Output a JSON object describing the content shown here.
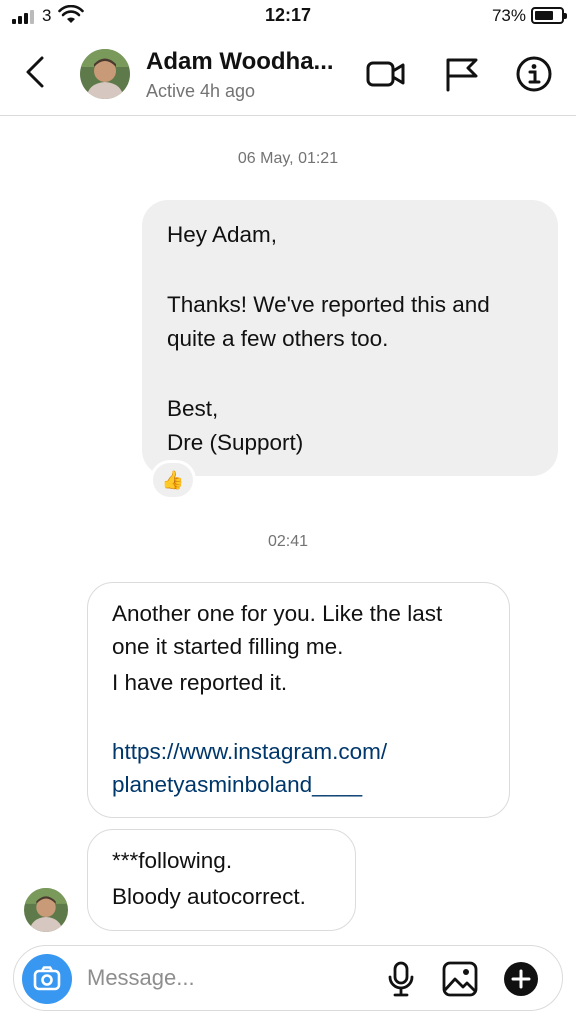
{
  "status_bar": {
    "carrier": "3",
    "time": "12:17",
    "battery": "73%",
    "battery_level": 0.73
  },
  "header": {
    "contact_name": "Adam Woodha...",
    "status": "Active 4h ago",
    "icons": [
      "back-icon",
      "video-call-icon",
      "flag-icon",
      "info-icon"
    ]
  },
  "messages": {
    "timestamp_1": "06 May, 01:21",
    "sent_1": {
      "line1": "Hey Adam,",
      "line2": "Thanks! We've reported this and",
      "line3": "quite a few others too.",
      "line4": "Best,",
      "line5": "Dre (Support)",
      "reaction": "👍"
    },
    "timestamp_2": "02:41",
    "received_1": {
      "line1": "Another one for you. Like the last",
      "line2": "one it started filling me.",
      "line3": "I have reported it.",
      "link1": "https://www.instagram.com/",
      "link2": "planetyasminboland____"
    },
    "received_2": {
      "line1": "***following.",
      "line2": "Bloody autocorrect."
    }
  },
  "composer": {
    "placeholder": "Message...",
    "icons": [
      "camera-icon",
      "microphone-icon",
      "gallery-icon",
      "plus-icon"
    ]
  },
  "colors": {
    "accent": "#3897f0",
    "link": "#00376b",
    "sent_bubble": "#efefef",
    "border": "#dbdbdb",
    "muted_text": "#737373"
  }
}
